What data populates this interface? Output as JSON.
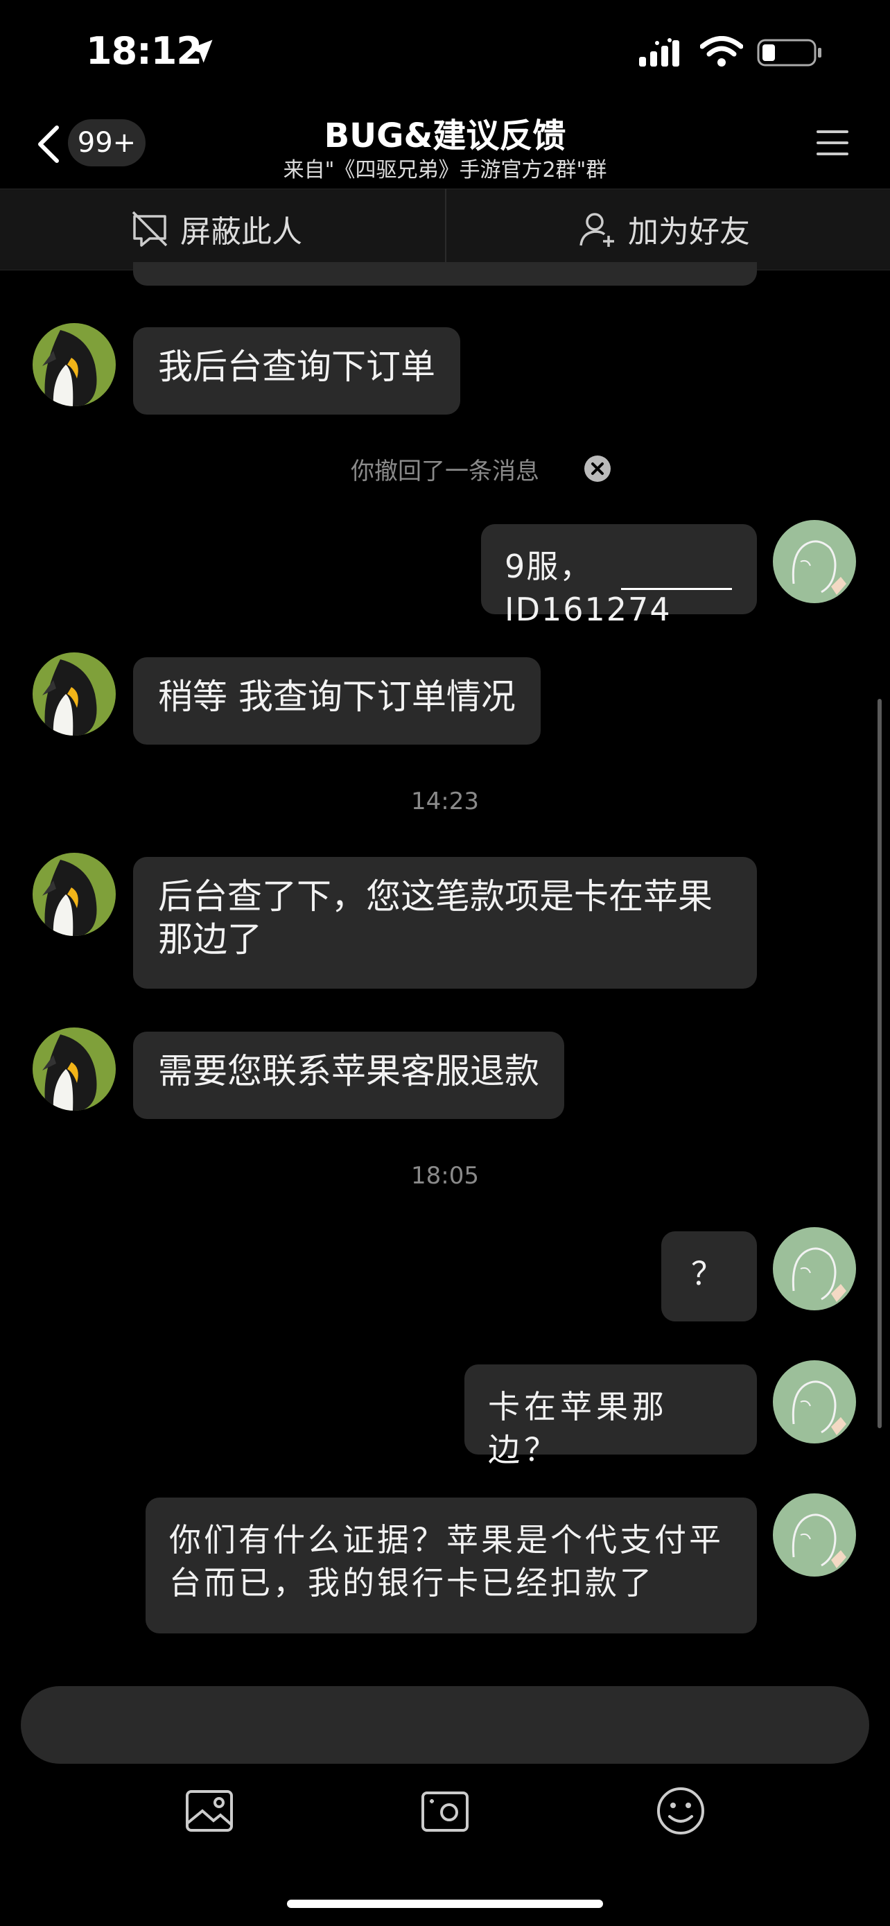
{
  "status": {
    "time": "18:12"
  },
  "header": {
    "badge": "99+",
    "title": "BUG&建议反馈",
    "subtitle": "来自\"《四驱兄弟》手游官方2群\"群"
  },
  "actions": {
    "block": "屏蔽此人",
    "add_friend": "加为好友"
  },
  "messages": {
    "m1": "我后台查询下订单",
    "recall": "你撤回了一条消息",
    "m2": "9服，ID161274",
    "m3": "稍等 我查询下订单情况",
    "t1": "14:23",
    "m4a": "后台查了下，您这笔款项是卡在苹果",
    "m4b": "那边了",
    "m5": "需要您联系苹果客服退款",
    "t2": "18:05",
    "m6": "？",
    "m7": "卡在苹果那边？",
    "m8a": "你们有什么证据？苹果是个代支付平",
    "m8b": "台而已，我的银行卡已经扣款了"
  },
  "icons": {
    "tools": [
      "image-icon",
      "camera-icon",
      "emoji-icon"
    ],
    "agent_avatar": "penguin-avatar",
    "user_avatar": "green-sketch-avatar"
  },
  "colors": {
    "bubble": "#2a2a2a",
    "background": "#000000",
    "avatar_user_bg": "#9cbf9a"
  }
}
